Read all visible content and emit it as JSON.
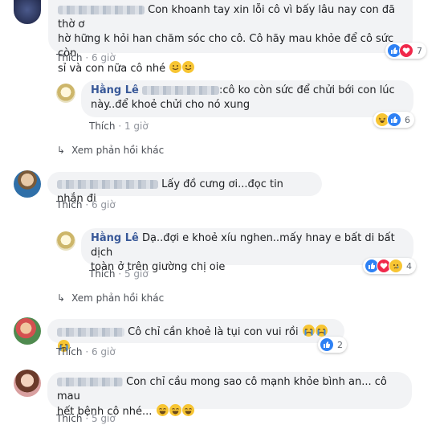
{
  "comments": [
    {
      "line1": "Con khoanh tay xin lỗi cô vì bấy lâu nay con đã thờ ơ",
      "line2": "hờ hững k hỏi han chăm sóc cho cô. Cô hãy mau khỏe để cô sức còn",
      "line3": "sỉ và con nữa cô nhé",
      "like": "Thích",
      "time": "6 giờ",
      "react_count": "7"
    },
    {
      "name": "Hằng Lê",
      "line1": ":cô ko còn sức để chửi bới con lúc",
      "line2": "này..để khoẻ chửi cho nó xung",
      "like": "Thích",
      "time": "1 giờ",
      "react_count": "6"
    },
    {
      "text": "Lấy đồ cưng ơi...đọc tin nhắn đi",
      "like": "Thích",
      "time": "6 giờ"
    },
    {
      "name": "Hằng Lê",
      "line1": "Dạ..đợi e khoẻ xíu nghen..mấy hnay e bất di bất dịch",
      "line2": "toàn ở trên giường chị oie",
      "like": "Thích",
      "time": "5 giờ",
      "react_count": "4"
    },
    {
      "text": "Cô chỉ cần khoẻ là tụi con vui rồi",
      "like": "Thích",
      "time": "6 giờ",
      "react_count": "2"
    },
    {
      "line1": "Con chỉ cầu mong sao cô mạnh khỏe bình an... cô mau",
      "line2": "hết bệnh cô nhé...",
      "like": "Thích",
      "time": "5 giờ"
    }
  ],
  "more_replies": [
    "Xem phản hồi khác",
    "Xem phản hồi khác"
  ],
  "colors": {
    "link": "#385898",
    "like_blue": "#2e81f4",
    "love_red": "#f0284a",
    "haha_yellow": "#f7c533",
    "bubble": "#f2f3f5"
  },
  "icons": [
    "like-icon",
    "love-icon",
    "haha-icon",
    "sad-icon",
    "smile-emoji",
    "cry-emoji",
    "grin-emoji",
    "reply-arrow-icon"
  ]
}
